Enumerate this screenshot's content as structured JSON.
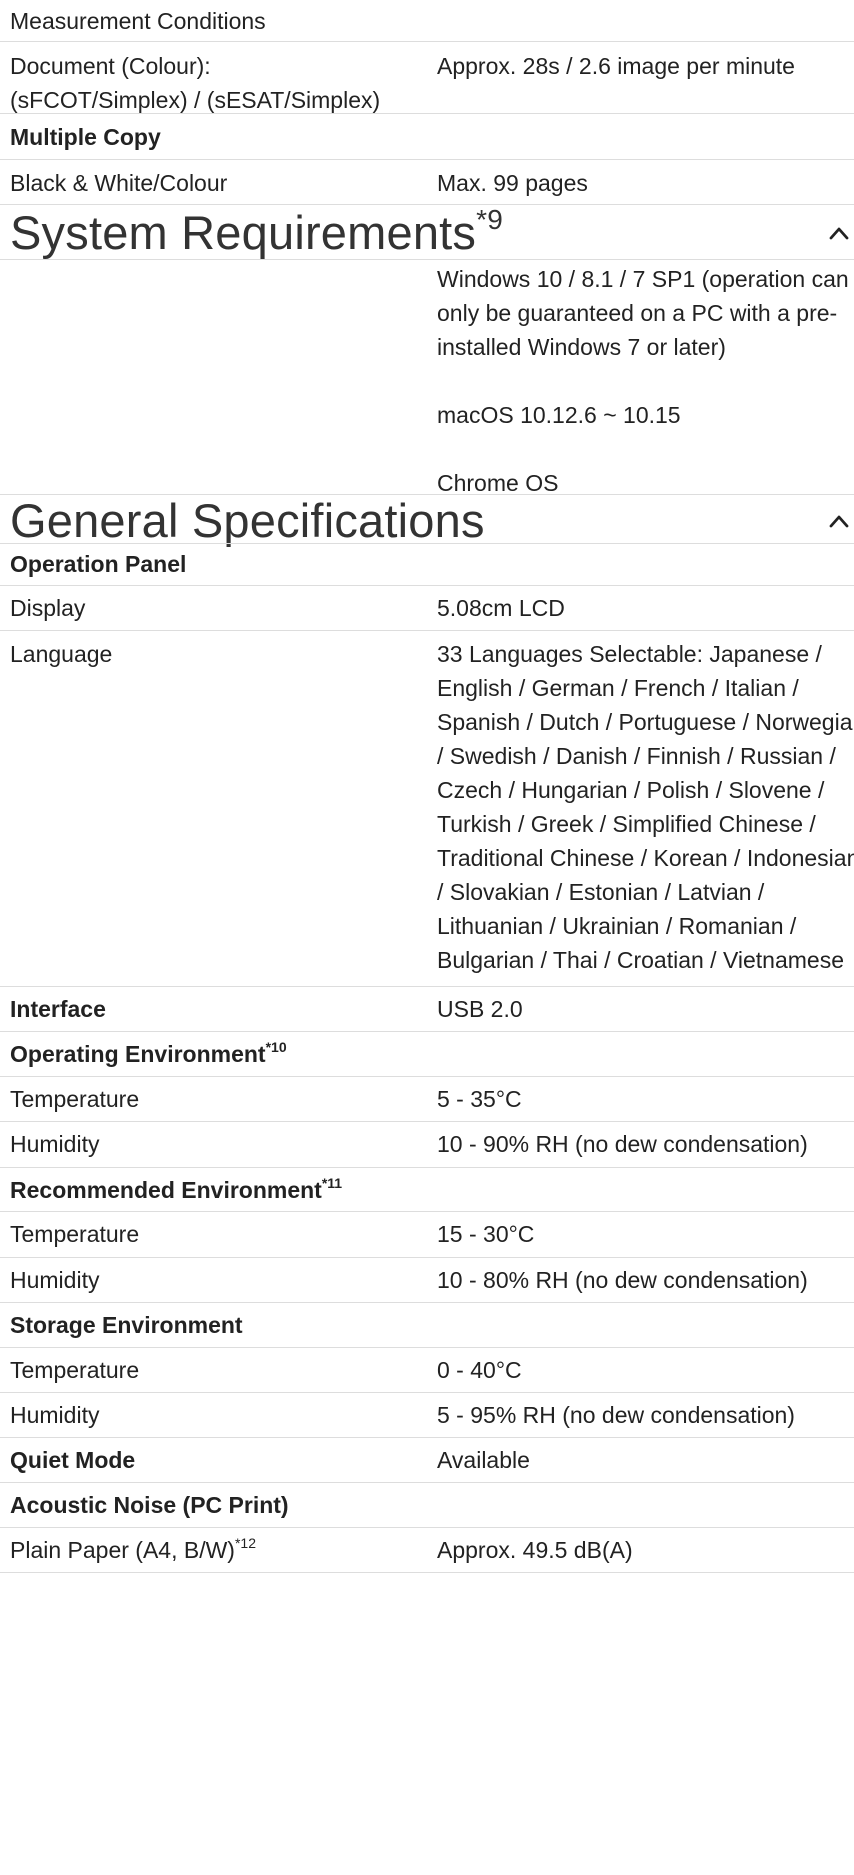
{
  "top_rows": {
    "measurement": "Measurement Conditions",
    "document_label_1": "Document (Colour):",
    "document_label_2": "(sFCOT/Simplex) / (sESAT/Simplex)",
    "document_value": "Approx. 28s / 2.6 image per minute",
    "multiple_copy": "Multiple Copy",
    "bw_colour_label": "Black & White/Colour",
    "bw_colour_value": "Max. 99 pages"
  },
  "system_requirements": {
    "title": "System Requirements",
    "footnote": "*9",
    "icon": "chevron-up-icon",
    "windows": "Windows 10 / 8.1 / 7 SP1 (operation can only be guaranteed on a PC with a pre-installed Windows 7 or later)",
    "macos": "macOS 10.12.6 ~ 10.15",
    "chrome": "Chrome OS"
  },
  "general": {
    "title": "General Specifications",
    "icon": "chevron-up-icon",
    "operation_panel": "Operation Panel",
    "display_label": "Display",
    "display_value": "5.08cm LCD",
    "language_label": "Language",
    "language_value": "33 Languages Selectable: Japanese / English / German / French / Italian / Spanish / Dutch / Portuguese / Norwegian / Swedish / Danish / Finnish / Russian / Czech / Hungarian / Polish / Slovene / Turkish / Greek / Simplified Chinese / Traditional Chinese / Korean / Indonesian / Slovakian / Estonian / Latvian / Lithuanian / Ukrainian / Romanian / Bulgarian / Thai / Croatian / Vietnamese",
    "interface_label": "Interface",
    "interface_value": "USB 2.0",
    "operating_env": "Operating Environment",
    "operating_env_note": "*10",
    "op_temp_label": "Temperature",
    "op_temp_value": "5 - 35°C",
    "op_hum_label": "Humidity",
    "op_hum_value": "10 - 90% RH (no dew condensation)",
    "recommended_env": "Recommended Environment",
    "recommended_env_note": "*11",
    "rec_temp_label": "Temperature",
    "rec_temp_value": "15 - 30°C",
    "rec_hum_label": "Humidity",
    "rec_hum_value": "10 - 80% RH (no dew condensation)",
    "storage_env": "Storage Environment",
    "st_temp_label": "Temperature",
    "st_temp_value": "0 - 40°C",
    "st_hum_label": "Humidity",
    "st_hum_value": "5 - 95% RH (no dew condensation)",
    "quiet_label": "Quiet Mode",
    "quiet_value": "Available",
    "acoustic": "Acoustic Noise (PC Print)",
    "plain_label": "Plain Paper (A4, B/W)",
    "plain_note": "*12",
    "plain_value": "Approx. 49.5 dB(A)"
  }
}
